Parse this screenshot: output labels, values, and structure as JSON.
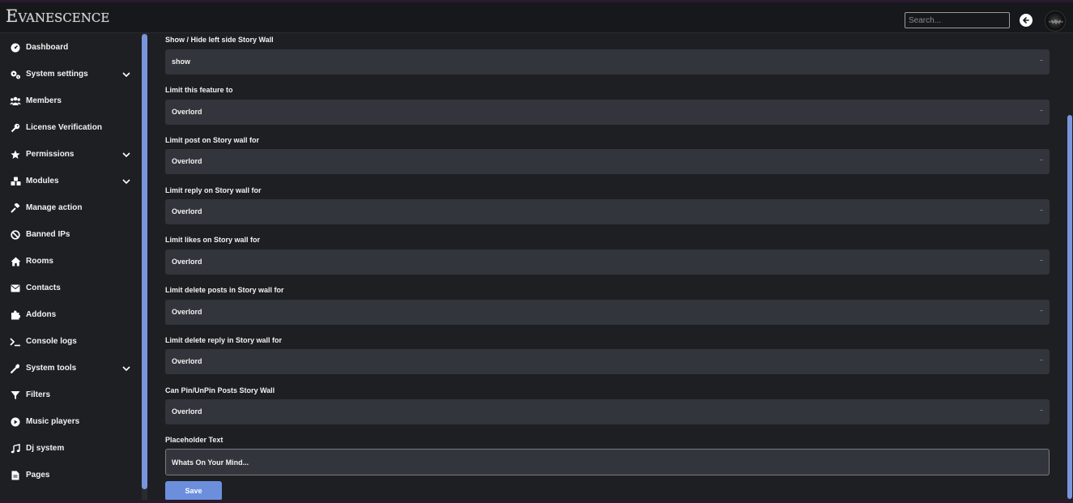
{
  "header": {
    "logo_text": "Evanescence",
    "search_placeholder": "Search...",
    "back_icon": "arrow-left-icon",
    "avatar_icon": "user-avatar"
  },
  "sidebar": {
    "items": [
      {
        "label": "Dashboard",
        "icon": "dashboard-icon",
        "has_submenu": false
      },
      {
        "label": "System settings",
        "icon": "gears-icon",
        "has_submenu": true
      },
      {
        "label": "Members",
        "icon": "users-icon",
        "has_submenu": false
      },
      {
        "label": "License Verification",
        "icon": "key-icon",
        "has_submenu": false
      },
      {
        "label": "Permissions",
        "icon": "star-icon",
        "has_submenu": true
      },
      {
        "label": "Modules",
        "icon": "cubes-icon",
        "has_submenu": true
      },
      {
        "label": "Manage action",
        "icon": "gavel-icon",
        "has_submenu": false
      },
      {
        "label": "Banned IPs",
        "icon": "ban-icon",
        "has_submenu": false
      },
      {
        "label": "Rooms",
        "icon": "home-icon",
        "has_submenu": false
      },
      {
        "label": "Contacts",
        "icon": "envelope-icon",
        "has_submenu": false
      },
      {
        "label": "Addons",
        "icon": "puzzle-icon",
        "has_submenu": false
      },
      {
        "label": "Console logs",
        "icon": "terminal-icon",
        "has_submenu": false
      },
      {
        "label": "System tools",
        "icon": "wrench-icon",
        "has_submenu": true
      },
      {
        "label": "Filters",
        "icon": "filter-icon",
        "has_submenu": false
      },
      {
        "label": "Music players",
        "icon": "play-circle-icon",
        "has_submenu": false
      },
      {
        "label": "Dj system",
        "icon": "music-icon",
        "has_submenu": false
      },
      {
        "label": "Pages",
        "icon": "file-icon",
        "has_submenu": false
      }
    ]
  },
  "form": {
    "fields": [
      {
        "label": "Show / Hide left side Story Wall",
        "value": "show"
      },
      {
        "label": "Limit this feature to",
        "value": "Overlord"
      },
      {
        "label": "Limit post on Story wall for",
        "value": "Overlord"
      },
      {
        "label": "Limit reply on Story wall for",
        "value": "Overlord"
      },
      {
        "label": "Limit likes on Story wall for",
        "value": "Overlord"
      },
      {
        "label": "Limit delete posts in Story wall for",
        "value": "Overlord"
      },
      {
        "label": "Limit delete reply in Story wall for",
        "value": "Overlord"
      },
      {
        "label": "Can Pin/UnPin Posts Story Wall",
        "value": "Overlord"
      }
    ],
    "placeholder_label": "Placeholder Text",
    "placeholder_value": "Whats On Your Mind...",
    "save_label": "Save"
  },
  "colors": {
    "accent": "#6b8fdc",
    "background": "#1e1f23",
    "topbar": "#17181b",
    "select_bg": "#33353c"
  }
}
